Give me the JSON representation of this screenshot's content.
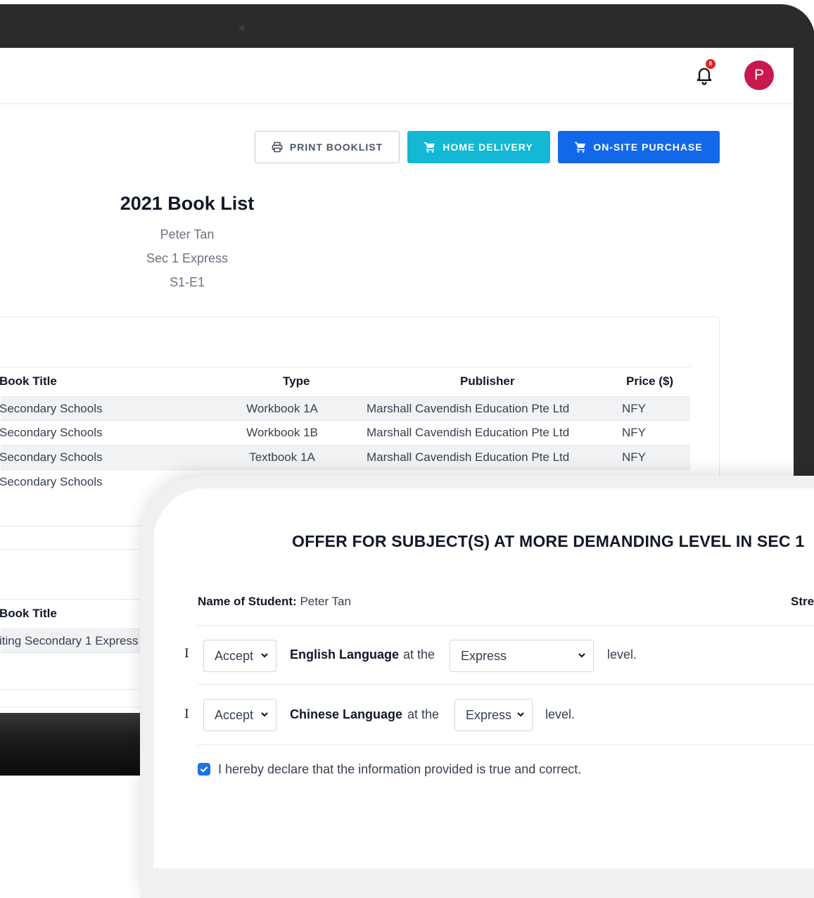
{
  "topbar": {
    "notification_count": "8",
    "avatar_initial": "P"
  },
  "toolbar": {
    "print_label": "PRINT BOOKLIST",
    "home_delivery_label": "HOME DELIVERY",
    "onsite_label": "ON-SITE PURCHASE"
  },
  "booklist": {
    "title": "2021 Book List",
    "student": "Peter Tan",
    "class_level": "Sec 1 Express",
    "class_code": "S1-E1"
  },
  "table1": {
    "headers": [
      "Book Title",
      "Type",
      "Publisher",
      "Price ($)"
    ],
    "rows": [
      [
        "Secondary Schools",
        "Workbook 1A",
        "Marshall Cavendish Education Pte Ltd",
        "NFY"
      ],
      [
        "Secondary Schools",
        "Workbook 1B",
        "Marshall Cavendish Education Pte Ltd",
        "NFY"
      ],
      [
        "Secondary Schools",
        "Textbook 1A",
        "Marshall Cavendish Education Pte Ltd",
        "NFY"
      ],
      [
        "Secondary Schools",
        "",
        "",
        ""
      ]
    ]
  },
  "table2": {
    "headers": [
      "Book Title"
    ],
    "rows": [
      [
        "iting Secondary 1 Express"
      ]
    ]
  },
  "offer": {
    "title": "OFFER FOR SUBJECT(S) AT MORE DEMANDING LEVEL IN SEC 1",
    "student_label": "Name of Student:",
    "student_name": "Peter Tan",
    "stream_label": "Stre",
    "rows": [
      {
        "pronoun": "I",
        "decision": "Accept",
        "subject": "English Language",
        "at_the": "at the",
        "level": "Express",
        "suffix": "level."
      },
      {
        "pronoun": "I",
        "decision": "Accept",
        "subject": "Chinese Language",
        "at_the": "at the",
        "level": "Express",
        "suffix": "level."
      }
    ],
    "declaration": "I hereby declare that the information provided is true and correct.",
    "declaration_checked": true
  },
  "colors": {
    "home_delivery": "#14b8d4",
    "onsite": "#1268e8",
    "avatar": "#c8194f",
    "badge": "#e02424",
    "checkbox": "#1a73e8"
  }
}
